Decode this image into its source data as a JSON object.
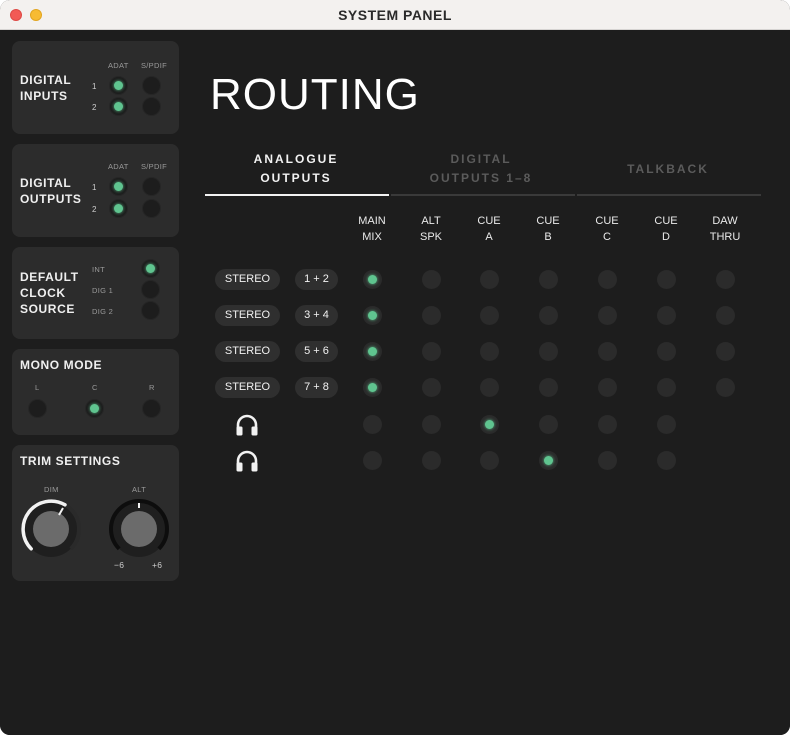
{
  "window": {
    "title": "SYSTEM PANEL"
  },
  "sidebar": {
    "digital_inputs": {
      "title_line1": "DIGITAL",
      "title_line2": "INPUTS",
      "col_adat": "ADAT",
      "col_spdif": "S/PDIF",
      "row1": "1",
      "row2": "2"
    },
    "digital_outputs": {
      "title_line1": "DIGITAL",
      "title_line2": "OUTPUTS",
      "col_adat": "ADAT",
      "col_spdif": "S/PDIF",
      "row1": "1",
      "row2": "2"
    },
    "clock": {
      "title_line1": "DEFAULT",
      "title_line2": "CLOCK",
      "title_line3": "SOURCE",
      "opt_int": "INT",
      "opt_dig1": "DIG 1",
      "opt_dig2": "DIG 2",
      "selected": "INT"
    },
    "mono": {
      "title": "MONO MODE",
      "l": "L",
      "c": "C",
      "r": "R",
      "selected": "C"
    },
    "trim": {
      "title": "TRIM SETTINGS",
      "dim": "DIM",
      "alt": "ALT",
      "min": "−6",
      "max": "+6"
    }
  },
  "main": {
    "title": "ROUTING",
    "tabs": [
      {
        "line1": "ANALOGUE",
        "line2": "OUTPUTS",
        "active": true
      },
      {
        "line1": "DIGITAL",
        "line2": "OUTPUTS 1–8",
        "active": false
      },
      {
        "line1": "TALKBACK",
        "line2": "",
        "active": false
      }
    ],
    "columns": [
      {
        "l1": "MAIN",
        "l2": "MIX"
      },
      {
        "l1": "ALT",
        "l2": "SPK"
      },
      {
        "l1": "CUE",
        "l2": "A"
      },
      {
        "l1": "CUE",
        "l2": "B"
      },
      {
        "l1": "CUE",
        "l2": "C"
      },
      {
        "l1": "CUE",
        "l2": "D"
      },
      {
        "l1": "DAW",
        "l2": "THRU"
      }
    ],
    "rows": [
      {
        "mode": "STEREO",
        "pair": "1 + 2"
      },
      {
        "mode": "STEREO",
        "pair": "3 + 4"
      },
      {
        "mode": "STEREO",
        "pair": "5 + 6"
      },
      {
        "mode": "STEREO",
        "pair": "7 + 8"
      },
      {
        "mode": "",
        "pair": "",
        "icon": "headphones-icon"
      },
      {
        "mode": "",
        "pair": "",
        "icon": "headphones-icon"
      }
    ]
  },
  "colors": {
    "accent": "#5fc48f",
    "background": "#1d1d1d",
    "panel": "#2c2c2c"
  }
}
